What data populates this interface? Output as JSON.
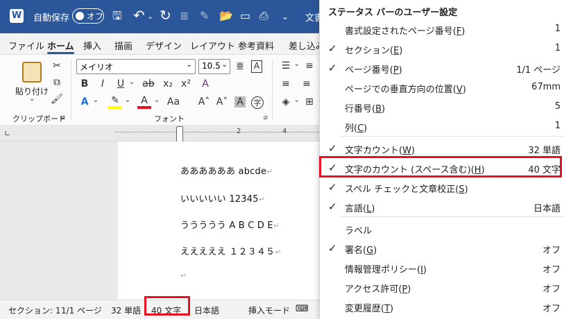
{
  "titlebar": {
    "autosave_label": "自動保存",
    "toggle_label": "オフ",
    "doc_partial": "文書"
  },
  "tabs": [
    {
      "label": "ファイル"
    },
    {
      "label": "ホーム"
    },
    {
      "label": "挿入"
    },
    {
      "label": "描画"
    },
    {
      "label": "デザイン"
    },
    {
      "label": "レイアウト"
    },
    {
      "label": "参考資料"
    },
    {
      "label": "差し込み"
    }
  ],
  "ribbon": {
    "paste_label": "貼り付け",
    "clipboard_label": "クリップボード",
    "font_name": "メイリオ",
    "font_size": "10.5",
    "font_group_label": "フォント",
    "ruler_marks": [
      "2",
      "4"
    ]
  },
  "document": {
    "lines": [
      "ああああああ abcde",
      "いいいいい 12345",
      "ううううう A B C D E",
      "えええええ １２３４５"
    ]
  },
  "statusbar": {
    "section": "セクション: 1",
    "page": "1/1 ページ",
    "words": "32 単語",
    "chars": "40 文字",
    "lang": "日本語",
    "mode": "挿入モード"
  },
  "menu": {
    "title": "ステータス バーのユーザー設定",
    "items": [
      {
        "label": "書式設定されたページ番号(",
        "key": "F",
        "value": "1",
        "checked": false
      },
      {
        "label": "セクション(",
        "key": "E",
        "value": "1",
        "checked": true
      },
      {
        "label": "ページ番号(",
        "key": "P",
        "value": "1/1 ページ",
        "checked": true
      },
      {
        "label": "ページでの垂直方向の位置(",
        "key": "V",
        "value": "67mm",
        "checked": false
      },
      {
        "label": "行番号(",
        "key": "B",
        "value": "5",
        "checked": false
      },
      {
        "label": "列(",
        "key": "C",
        "value": "1",
        "checked": false
      },
      {
        "label": "文字カウント(",
        "key": "W",
        "value": "32 単語",
        "checked": true
      },
      {
        "label": "文字のカウント (スペース含む)(",
        "key": "H",
        "value": "40 文字",
        "checked": true
      },
      {
        "label": "スペル チェックと文章校正(",
        "key": "S",
        "value": "",
        "checked": true
      },
      {
        "label": "言語(",
        "key": "L",
        "value": "日本語",
        "checked": true
      },
      {
        "label": "ラベル",
        "key": "",
        "value": "",
        "checked": false
      },
      {
        "label": "署名(",
        "key": "G",
        "value": "オフ",
        "checked": true
      },
      {
        "label": "情報管理ポリシー(",
        "key": "I",
        "value": "オフ",
        "checked": false
      },
      {
        "label": "アクセス許可(",
        "key": "P",
        "value": "オフ",
        "checked": false
      },
      {
        "label": "変更履歴(",
        "key": "T",
        "value": "オフ",
        "checked": false
      }
    ]
  },
  "colors": {
    "title_bar": "#2b579a",
    "highlight": "#e81123"
  }
}
